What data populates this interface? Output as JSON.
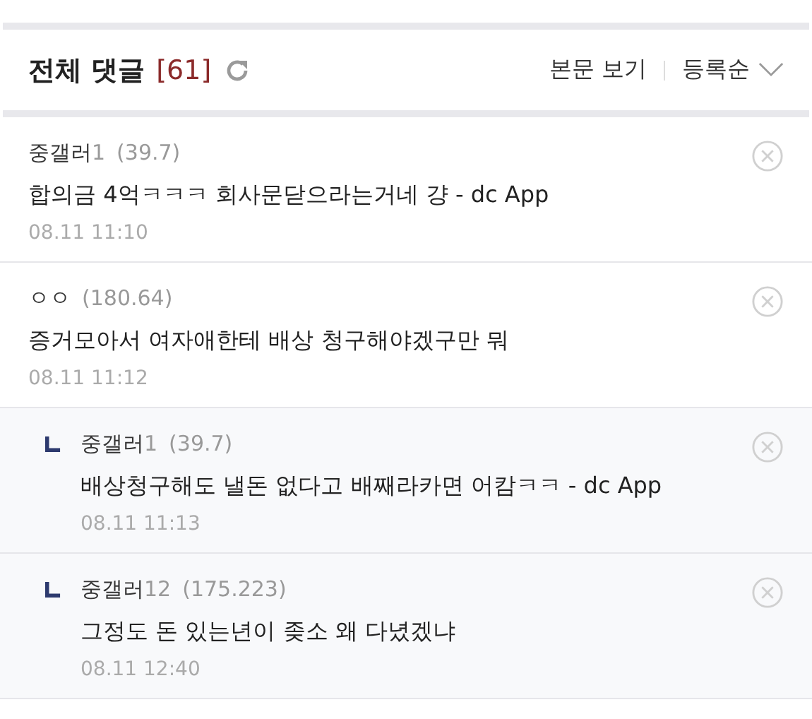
{
  "header": {
    "title": "전체 댓글",
    "count": "[61]",
    "view_post": "본문 보기",
    "sort": "등록순"
  },
  "comments": [
    {
      "nick": "중갤러",
      "nick_tag": "1",
      "ip": "(39.7)",
      "text": "합의금 4억ㅋㅋㅋ 회사문닫으라는거네 걍 - dc App",
      "date": "08.11 11:10"
    },
    {
      "nick": "ㅇㅇ",
      "ip": "(180.64)",
      "text": "증거모아서 여자애한테 배상 청구해야겠구만 뭐",
      "date": "08.11 11:12",
      "children": [
        {
          "nick": "중갤러",
          "nick_tag": "1",
          "ip": "(39.7)",
          "text": "배상청구해도 낼돈 없다고 배째라카면 어캄ㅋㅋ - dc App",
          "date": "08.11 11:13"
        },
        {
          "nick": "중갤러",
          "nick_tag": "12",
          "ip": "(175.223)",
          "text": "그정도 돈 있는년이 좆소 왜 다녔겠냐",
          "date": "08.11 12:40"
        }
      ]
    }
  ]
}
